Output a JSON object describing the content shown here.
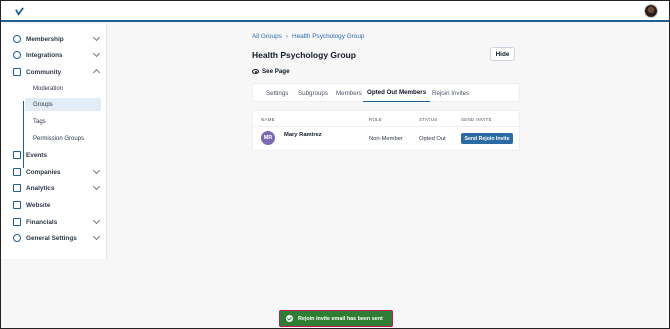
{
  "sidebar": {
    "items": [
      {
        "label": "Membership",
        "icon": "users-icon"
      },
      {
        "label": "Integrations",
        "icon": "link-icon"
      },
      {
        "label": "Community",
        "icon": "book-icon"
      },
      {
        "label": "Events",
        "icon": "calendar-icon"
      },
      {
        "label": "Companies",
        "icon": "building-icon"
      },
      {
        "label": "Analytics",
        "icon": "chart-icon"
      },
      {
        "label": "Website",
        "icon": "globe-icon"
      },
      {
        "label": "Financials",
        "icon": "wallet-icon"
      },
      {
        "label": "General Settings",
        "icon": "gear-icon"
      }
    ],
    "community_sub": [
      "Moderation",
      "Groups",
      "Tags",
      "Permission Groups"
    ]
  },
  "breadcrumb": {
    "root": "All Groups",
    "sep": "›",
    "current": "Health Psychology Group"
  },
  "page": {
    "title": "Health Psychology Group",
    "hide_label": "Hide",
    "see_page_label": "See Page"
  },
  "tabs": [
    "Settings",
    "Subgroups",
    "Members",
    "Opted Out Members",
    "Rejoin Invites"
  ],
  "table": {
    "headers": [
      "NAME",
      "ROLE",
      "STATUS",
      "SEND INVITE"
    ],
    "rows": [
      {
        "initials": "MR",
        "name": "Mary Ramirez",
        "role": "Non-Member",
        "status": "Opted Out",
        "action": "Send Rejoin Invite"
      }
    ]
  },
  "toast": {
    "message": "Rejoin invite email has been sent"
  },
  "colors": {
    "accent": "#1e5f94",
    "button": "#2c6aa3",
    "toast": "#2e7d32",
    "avatar": "#7b6ab1"
  }
}
